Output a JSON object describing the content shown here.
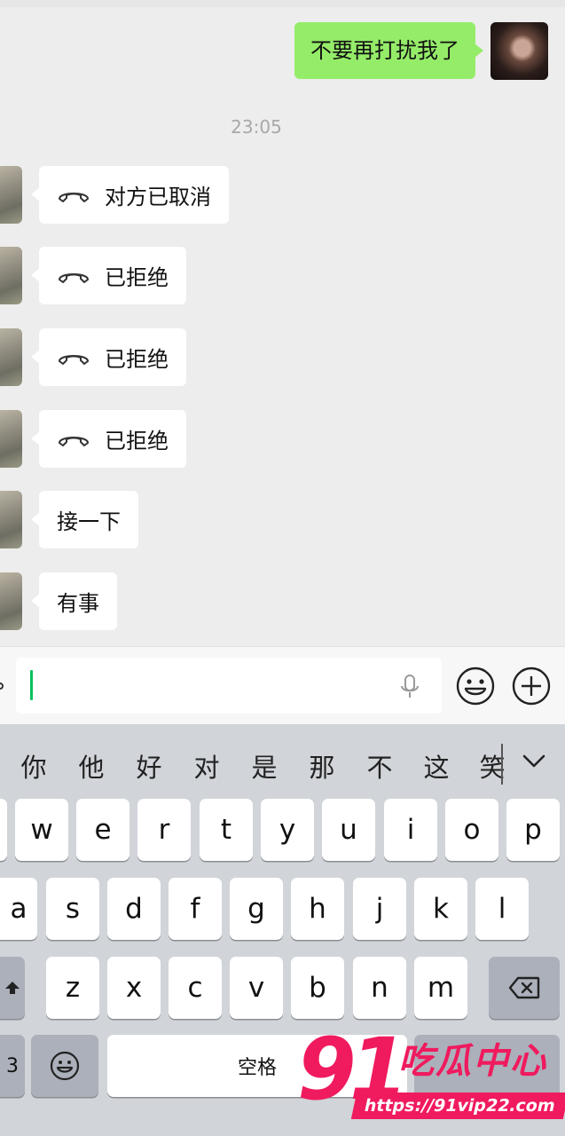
{
  "chat": {
    "outgoing_message": "不要再打扰我了",
    "timestamp": "23:05",
    "incoming": [
      {
        "icon": "phone-hangup-icon",
        "text": "对方已取消"
      },
      {
        "icon": "phone-hangup-icon",
        "text": "已拒绝"
      },
      {
        "icon": "phone-hangup-icon",
        "text": "已拒绝"
      },
      {
        "icon": "phone-hangup-icon",
        "text": "已拒绝"
      },
      {
        "icon": null,
        "text": "接一下"
      },
      {
        "icon": null,
        "text": "有事"
      }
    ]
  },
  "input": {
    "value": "",
    "icons": [
      "microphone-icon",
      "emoji-icon",
      "plus-icon"
    ]
  },
  "keyboard": {
    "candidates": [
      "你",
      "他",
      "好",
      "对",
      "是",
      "那",
      "不",
      "这",
      "笑"
    ],
    "row1": [
      "w",
      "e",
      "r",
      "t",
      "y",
      "u",
      "i",
      "o",
      "p"
    ],
    "row2": [
      "a",
      "s",
      "d",
      "f",
      "g",
      "h",
      "j",
      "k",
      "l"
    ],
    "row3": [
      "z",
      "x",
      "c",
      "v",
      "b",
      "n",
      "m"
    ],
    "space_label": "空格",
    "partial_left_b": "3"
  },
  "watermark": {
    "number": "91",
    "brand": "吃瓜中心",
    "url": "https://91vip22.com"
  },
  "colors": {
    "outgoing_bubble": "#95ec69",
    "caret": "#07c160",
    "watermark": "#f01a5e"
  }
}
